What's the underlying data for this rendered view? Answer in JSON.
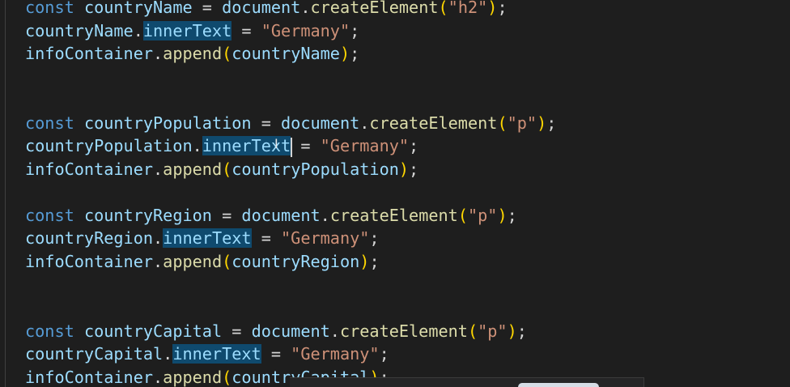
{
  "editor": {
    "lines": [
      [
        {
          "t": "const",
          "c": "kw"
        },
        {
          "t": " ",
          "c": "op"
        },
        {
          "t": "countryName",
          "c": "var"
        },
        {
          "t": " = ",
          "c": "op"
        },
        {
          "t": "document",
          "c": "var"
        },
        {
          "t": ".",
          "c": "op"
        },
        {
          "t": "createElement",
          "c": "fn"
        },
        {
          "t": "(",
          "c": "br"
        },
        {
          "t": "\"h2\"",
          "c": "str"
        },
        {
          "t": ")",
          "c": "br"
        },
        {
          "t": ";",
          "c": "op"
        }
      ],
      [
        {
          "t": "countryName",
          "c": "var"
        },
        {
          "t": ".",
          "c": "op"
        },
        {
          "t": "innerText",
          "c": "var",
          "hl": true
        },
        {
          "t": " = ",
          "c": "op"
        },
        {
          "t": "\"Germany\"",
          "c": "str"
        },
        {
          "t": ";",
          "c": "op"
        }
      ],
      [
        {
          "t": "infoContainer",
          "c": "var"
        },
        {
          "t": ".",
          "c": "op"
        },
        {
          "t": "append",
          "c": "fn"
        },
        {
          "t": "(",
          "c": "br"
        },
        {
          "t": "countryName",
          "c": "var"
        },
        {
          "t": ")",
          "c": "br"
        },
        {
          "t": ";",
          "c": "op"
        }
      ],
      [],
      [],
      [
        {
          "t": "const",
          "c": "kw"
        },
        {
          "t": " ",
          "c": "op"
        },
        {
          "t": "countryPopulation",
          "c": "var"
        },
        {
          "t": " = ",
          "c": "op"
        },
        {
          "t": "document",
          "c": "var"
        },
        {
          "t": ".",
          "c": "op"
        },
        {
          "t": "createElement",
          "c": "fn"
        },
        {
          "t": "(",
          "c": "br"
        },
        {
          "t": "\"p\"",
          "c": "str"
        },
        {
          "t": ")",
          "c": "br"
        },
        {
          "t": ";",
          "c": "op"
        }
      ],
      [
        {
          "t": "countryPopulation",
          "c": "var"
        },
        {
          "t": ".",
          "c": "op"
        },
        {
          "t": "innerText",
          "c": "var",
          "hl": true,
          "cursor": true
        },
        {
          "t": " = ",
          "c": "op"
        },
        {
          "t": "\"Germany\"",
          "c": "str"
        },
        {
          "t": ";",
          "c": "op"
        }
      ],
      [
        {
          "t": "infoContainer",
          "c": "var"
        },
        {
          "t": ".",
          "c": "op"
        },
        {
          "t": "append",
          "c": "fn"
        },
        {
          "t": "(",
          "c": "br"
        },
        {
          "t": "countryPopulation",
          "c": "var"
        },
        {
          "t": ")",
          "c": "br"
        },
        {
          "t": ";",
          "c": "op"
        }
      ],
      [],
      [
        {
          "t": "const",
          "c": "kw"
        },
        {
          "t": " ",
          "c": "op"
        },
        {
          "t": "countryRegion",
          "c": "var"
        },
        {
          "t": " = ",
          "c": "op"
        },
        {
          "t": "document",
          "c": "var"
        },
        {
          "t": ".",
          "c": "op"
        },
        {
          "t": "createElement",
          "c": "fn"
        },
        {
          "t": "(",
          "c": "br"
        },
        {
          "t": "\"p\"",
          "c": "str"
        },
        {
          "t": ")",
          "c": "br"
        },
        {
          "t": ";",
          "c": "op"
        }
      ],
      [
        {
          "t": "countryRegion",
          "c": "var"
        },
        {
          "t": ".",
          "c": "op"
        },
        {
          "t": "innerText",
          "c": "var",
          "hl": true
        },
        {
          "t": " = ",
          "c": "op"
        },
        {
          "t": "\"Germany\"",
          "c": "str"
        },
        {
          "t": ";",
          "c": "op"
        }
      ],
      [
        {
          "t": "infoContainer",
          "c": "var"
        },
        {
          "t": ".",
          "c": "op"
        },
        {
          "t": "append",
          "c": "fn"
        },
        {
          "t": "(",
          "c": "br"
        },
        {
          "t": "countryRegion",
          "c": "var"
        },
        {
          "t": ")",
          "c": "br"
        },
        {
          "t": ";",
          "c": "op"
        }
      ],
      [],
      [],
      [
        {
          "t": "const",
          "c": "kw"
        },
        {
          "t": " ",
          "c": "op"
        },
        {
          "t": "countryCapital",
          "c": "var"
        },
        {
          "t": " = ",
          "c": "op"
        },
        {
          "t": "document",
          "c": "var"
        },
        {
          "t": ".",
          "c": "op"
        },
        {
          "t": "createElement",
          "c": "fn"
        },
        {
          "t": "(",
          "c": "br"
        },
        {
          "t": "\"p\"",
          "c": "str"
        },
        {
          "t": ")",
          "c": "br"
        },
        {
          "t": ";",
          "c": "op"
        }
      ],
      [
        {
          "t": "countryCapital",
          "c": "var"
        },
        {
          "t": ".",
          "c": "op"
        },
        {
          "t": "innerText",
          "c": "var",
          "hl": true
        },
        {
          "t": " = ",
          "c": "op"
        },
        {
          "t": "\"Germany\"",
          "c": "str"
        },
        {
          "t": ";",
          "c": "op"
        }
      ],
      [
        {
          "t": "infoContainer",
          "c": "var"
        },
        {
          "t": ".",
          "c": "op"
        },
        {
          "t": "append",
          "c": "fn"
        },
        {
          "t": "(",
          "c": "br"
        },
        {
          "t": "countryCapital",
          "c": "var"
        },
        {
          "t": ")",
          "c": "br"
        },
        {
          "t": ";",
          "c": "op"
        }
      ]
    ]
  },
  "colors": {
    "background": "#1e1e1e",
    "keyword": "#569cd6",
    "variable": "#9cdcfe",
    "function": "#dcdcaa",
    "string": "#ce9178",
    "bracket": "#ffd700",
    "highlight": "#0f4a6e"
  },
  "pointer": {
    "icon": "text-cursor-icon",
    "glyph": "I"
  }
}
